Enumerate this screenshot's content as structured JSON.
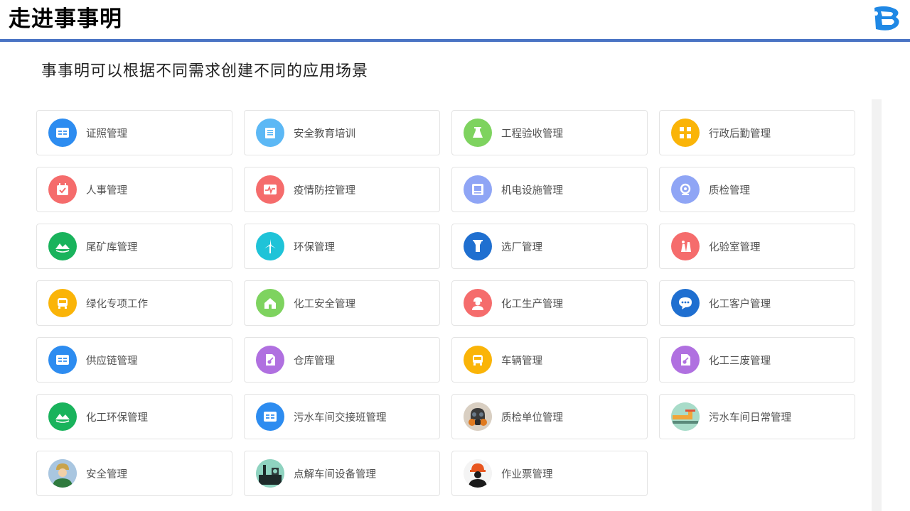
{
  "header": {
    "title": "走进事事明",
    "accent_color": "#4a74c4",
    "logo_icon": "brand-logo-b-icon"
  },
  "subtitle": "事事明可以根据不同需求创建不同的应用场景",
  "apps": [
    {
      "label": "证照管理",
      "icon": "id-card-icon",
      "color": "#2d8cf0"
    },
    {
      "label": "安全教育培训",
      "icon": "book-icon",
      "color": "#5cb8f5"
    },
    {
      "label": "工程验收管理",
      "icon": "flask-icon",
      "color": "#7ed35f"
    },
    {
      "label": "行政后勤管理",
      "icon": "grid-icon",
      "color": "#fab408"
    },
    {
      "label": "人事管理",
      "icon": "calendar-check-icon",
      "color": "#f56c6c"
    },
    {
      "label": "疫情防控管理",
      "icon": "pulse-icon",
      "color": "#f56c6c"
    },
    {
      "label": "机电设施管理",
      "icon": "monitor-icon",
      "color": "#8fa5f5"
    },
    {
      "label": "质检管理",
      "icon": "inspection-icon",
      "color": "#8fa5f5"
    },
    {
      "label": "尾矿库管理",
      "icon": "mountain-icon",
      "color": "#19b35c"
    },
    {
      "label": "环保管理",
      "icon": "wind-turbine-icon",
      "color": "#1fc3d8"
    },
    {
      "label": "选厂管理",
      "icon": "factory-icon",
      "color": "#1f6fd0"
    },
    {
      "label": "化验室管理",
      "icon": "lab-icon",
      "color": "#f56c6c"
    },
    {
      "label": "绿化专项工作",
      "icon": "bus-icon",
      "color": "#fab408"
    },
    {
      "label": "化工安全管理",
      "icon": "home-icon",
      "color": "#7ed35f"
    },
    {
      "label": "化工生产管理",
      "icon": "worker-icon",
      "color": "#f56c6c"
    },
    {
      "label": "化工客户管理",
      "icon": "chat-icon",
      "color": "#1f6fd0"
    },
    {
      "label": "供应链管理",
      "icon": "id-card-icon",
      "color": "#2d8cf0"
    },
    {
      "label": "仓库管理",
      "icon": "document-icon",
      "color": "#b070e0"
    },
    {
      "label": "车辆管理",
      "icon": "bus-icon",
      "color": "#fab408"
    },
    {
      "label": "化工三废管理",
      "icon": "document-icon",
      "color": "#b070e0"
    },
    {
      "label": "化工环保管理",
      "icon": "mountain-icon",
      "color": "#19b35c"
    },
    {
      "label": "污水车间交接班管理",
      "icon": "id-card-icon",
      "color": "#2d8cf0"
    },
    {
      "label": "质检单位管理",
      "icon": "gas-mask-icon",
      "color": "#cfc4b5"
    },
    {
      "label": "污水车间日常管理",
      "icon": "pipe-icon",
      "color": "#8fd3c0"
    },
    {
      "label": "安全管理",
      "icon": "worker-avatar-icon",
      "color": "#8fb4d8"
    },
    {
      "label": "点解车间设备管理",
      "icon": "workshop-icon",
      "color": "#8fd3c0"
    },
    {
      "label": "作业票管理",
      "icon": "hardhat-worker-icon",
      "color": "#f2f2f2"
    }
  ]
}
